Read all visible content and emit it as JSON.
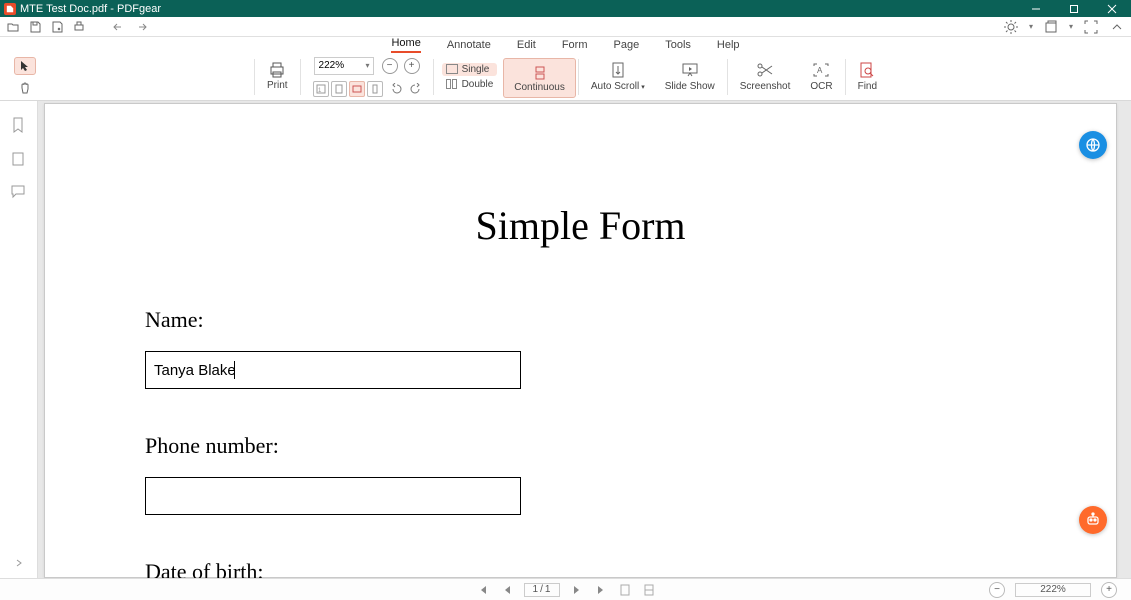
{
  "window": {
    "title": "MTE Test Doc.pdf - PDFgear"
  },
  "menu": {
    "tabs": [
      "Home",
      "Annotate",
      "Edit",
      "Form",
      "Page",
      "Tools",
      "Help"
    ],
    "active_index": 0
  },
  "ribbon": {
    "print": "Print",
    "zoom_value": "222%",
    "layout": {
      "single": "Single",
      "double": "Double"
    },
    "continuous": "Continuous",
    "auto_scroll": "Auto Scroll",
    "slide_show": "Slide Show",
    "screenshot": "Screenshot",
    "ocr": "OCR",
    "find": "Find"
  },
  "document": {
    "title": "Simple Form",
    "fields": {
      "name": {
        "label": "Name:",
        "value": "Tanya Blake"
      },
      "phone": {
        "label": "Phone number:",
        "value": ""
      },
      "dob": {
        "label": "Date of birth:"
      }
    }
  },
  "status": {
    "page_current": "1",
    "page_total": "1",
    "zoom": "222%"
  }
}
